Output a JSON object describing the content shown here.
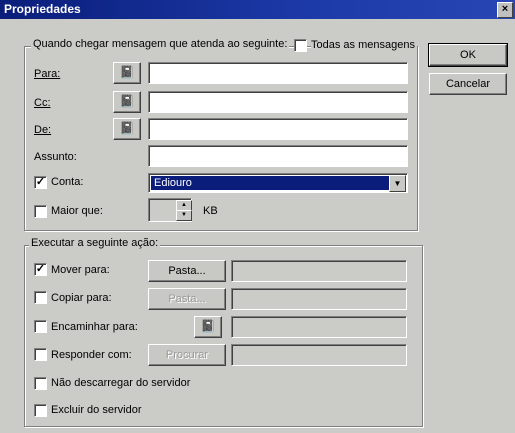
{
  "window": {
    "title": "Propriedades",
    "close_glyph": "×"
  },
  "buttons": {
    "ok": "OK",
    "cancel": "Cancelar"
  },
  "conditions": {
    "legend": "Quando chegar mensagem que atenda ao seguinte:",
    "all_messages": {
      "label": "Todas as mensagens",
      "checked": false
    },
    "para": {
      "label": "Para:",
      "value": ""
    },
    "cc": {
      "label": "Cc:",
      "value": ""
    },
    "de": {
      "label": "De:",
      "value": ""
    },
    "assunto": {
      "label": "Assunto:",
      "value": ""
    },
    "conta": {
      "label": "Conta:",
      "checked": true,
      "value": "Ediouro"
    },
    "maior_que": {
      "label": "Maior que:",
      "checked": false,
      "value": "",
      "unit": "KB"
    },
    "addressbook_icon": "address-book-icon"
  },
  "actions": {
    "legend": "Executar a seguinte ação:",
    "mover": {
      "label": "Mover para:",
      "checked": true,
      "button": "Pasta...",
      "value": ""
    },
    "copiar": {
      "label": "Copiar para:",
      "checked": false,
      "button": "Pasta...",
      "value": ""
    },
    "encaminhar": {
      "label": "Encaminhar para:",
      "checked": false,
      "value": ""
    },
    "responder": {
      "label": "Responder com:",
      "checked": false,
      "button": "Procurar",
      "value": ""
    },
    "nao_descarregar": {
      "label": "Não descarregar do servidor",
      "checked": false
    },
    "excluir": {
      "label": "Excluir do servidor",
      "checked": false
    }
  },
  "check_glyph": "✓"
}
